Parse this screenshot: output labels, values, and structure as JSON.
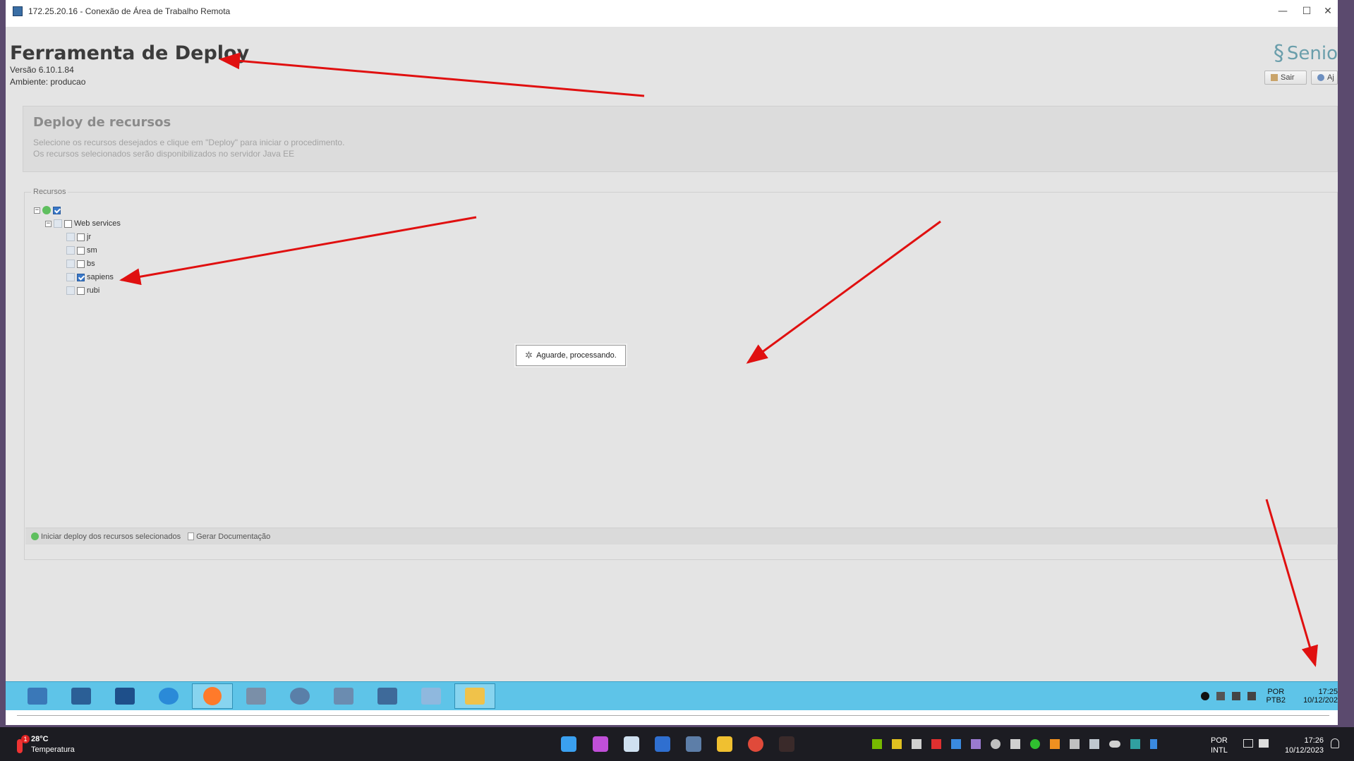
{
  "rdp": {
    "title": "172.25.20.16 - Conexão de Área de Trabalho Remota",
    "minimize_glyph": "—",
    "maximize_glyph": "☐",
    "close_glyph": "✕"
  },
  "app": {
    "title": "Ferramenta de Deploy",
    "version": "Versão 6.10.1.84",
    "environment": "Ambiente: producao",
    "logo_text": "Senio",
    "exit_button": "Sair",
    "help_button": "Aj"
  },
  "description": {
    "title": "Deploy de recursos",
    "line1": "Selecione os recursos desejados e clique em \"Deploy\" para iniciar o procedimento.",
    "line2": "Os recursos selecionados serão disponibilizados no servidor Java EE"
  },
  "resources": {
    "legend": "Recursos",
    "group_label": "Web services",
    "items": [
      {
        "label": "jr",
        "checked": false
      },
      {
        "label": "sm",
        "checked": false
      },
      {
        "label": "bs",
        "checked": false
      },
      {
        "label": "sapiens",
        "checked": true
      },
      {
        "label": "rubi",
        "checked": false
      }
    ]
  },
  "actions": {
    "deploy": "Iniciar deploy dos recursos selecionados",
    "docs": "Gerar Documentação"
  },
  "loading": {
    "text": "Aguarde, processando."
  },
  "remote_taskbar": {
    "lang_top": "POR",
    "lang_bottom": "PTB2",
    "time": "17:25",
    "date": "10/12/202"
  },
  "host_taskbar": {
    "temperature": "28°C",
    "weather_label": "Temperatura",
    "weather_badge": "1",
    "lang_top": "POR",
    "lang_bottom": "INTL",
    "time": "17:26",
    "date": "10/12/2023"
  },
  "colors": {
    "accent_remote_taskbar": "#5ec4e8",
    "annotation_arrows": "#e01010",
    "logo": "#6a9eab"
  }
}
